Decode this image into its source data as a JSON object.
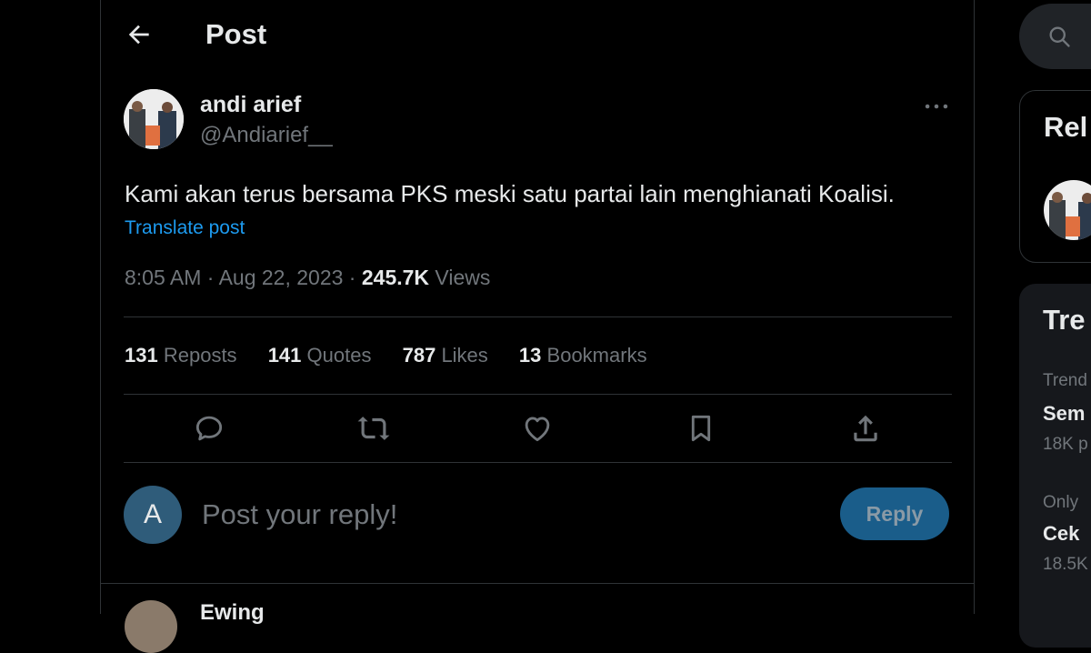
{
  "header": {
    "title": "Post"
  },
  "post": {
    "author_name": "andi arief",
    "author_handle": "@Andiarief__",
    "text": "Kami akan terus bersama PKS meski satu partai lain menghianati Koalisi.",
    "translate_label": "Translate post",
    "time": "8:05 AM",
    "date": "Aug 22, 2023",
    "views_count": "245.7K",
    "views_label": "Views"
  },
  "stats": [
    {
      "count": "131",
      "label": "Reposts"
    },
    {
      "count": "141",
      "label": "Quotes"
    },
    {
      "count": "787",
      "label": "Likes"
    },
    {
      "count": "13",
      "label": "Bookmarks"
    }
  ],
  "reply": {
    "avatar_letter": "A",
    "placeholder": "Post your reply!",
    "button_label": "Reply"
  },
  "next_reply": {
    "name_partial": "Ewing"
  },
  "sidebar": {
    "relevant_header_partial": "Rel",
    "trends_header_partial": "Tre",
    "trends": [
      {
        "context": "Trend",
        "name": "Sem",
        "count": "18K p"
      },
      {
        "context": "Only",
        "name": "Cek",
        "count": "18.5K"
      }
    ]
  },
  "colors": {
    "accent": "#1d9bf0",
    "background": "#000000",
    "muted": "#71767b"
  }
}
